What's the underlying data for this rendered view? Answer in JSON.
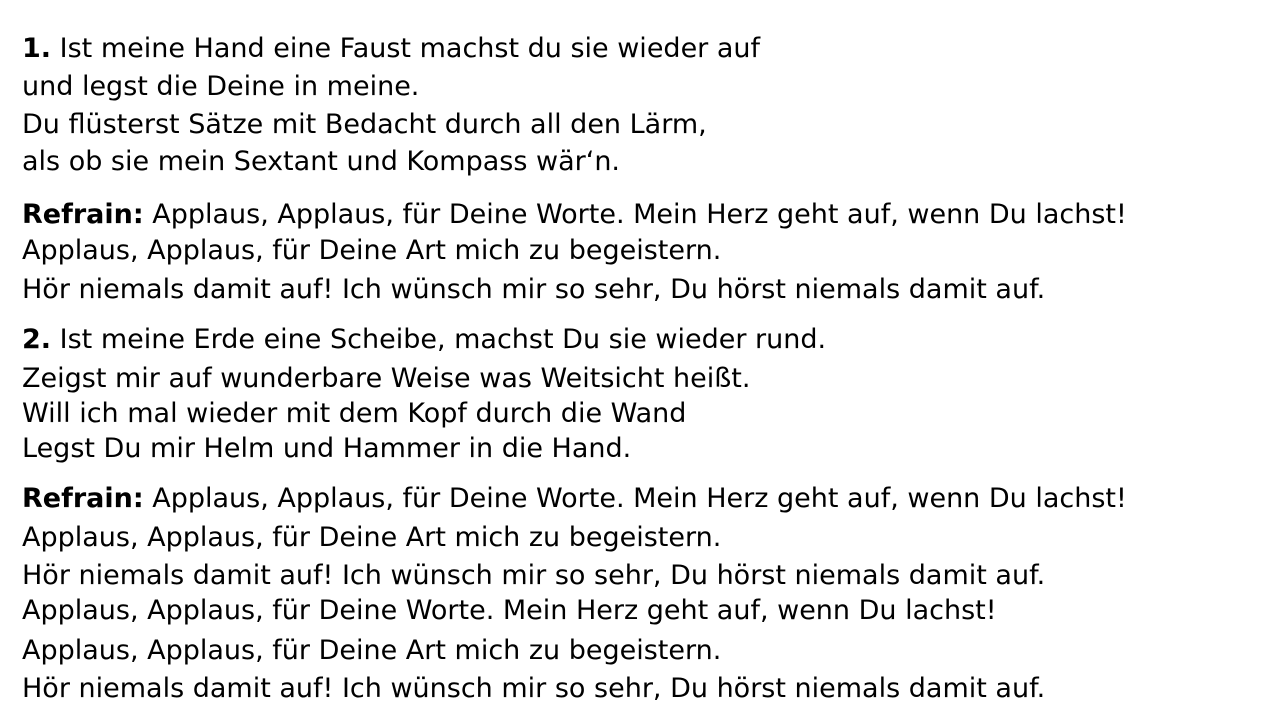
{
  "verse1": {
    "number": "1.",
    "lines": [
      " Ist meine Hand eine Faust machst du sie wieder auf",
      "und legst die Deine in meine.",
      "Du flüsterst Sätze mit Bedacht durch all den Lärm,",
      "als ob sie mein Sextant und Kompass wär‘n."
    ]
  },
  "refrain1": {
    "label": "Refrain:",
    "lines": [
      " Applaus, Applaus, für Deine Worte. Mein Herz geht auf, wenn Du lachst!",
      "Applaus, Applaus, für Deine Art mich zu begeistern.",
      "Hör niemals damit auf! Ich wünsch mir so sehr, Du hörst niemals damit auf."
    ]
  },
  "verse2": {
    "number": "2.",
    "lines": [
      " Ist meine Erde eine Scheibe, machst Du sie wieder rund.",
      "Zeigst mir auf wunderbare Weise was Weitsicht heißt.",
      "Will ich mal wieder mit dem Kopf durch die Wand",
      "Legst Du mir Helm und Hammer in die Hand."
    ]
  },
  "refrain2": {
    "label": "Refrain:",
    "lines": [
      " Applaus, Applaus, für Deine Worte. Mein Herz geht auf, wenn Du lachst!",
      "Applaus, Applaus, für Deine Art mich zu begeistern.",
      "Hör niemals damit auf! Ich wünsch mir so sehr, Du hörst niemals damit auf.",
      "Applaus, Applaus, für Deine Worte. Mein Herz geht auf, wenn Du lachst!",
      "Applaus, Applaus, für Deine Art mich zu begeistern.",
      "Hör niemals damit auf! Ich wünsch mir so sehr, Du hörst niemals damit auf."
    ]
  }
}
